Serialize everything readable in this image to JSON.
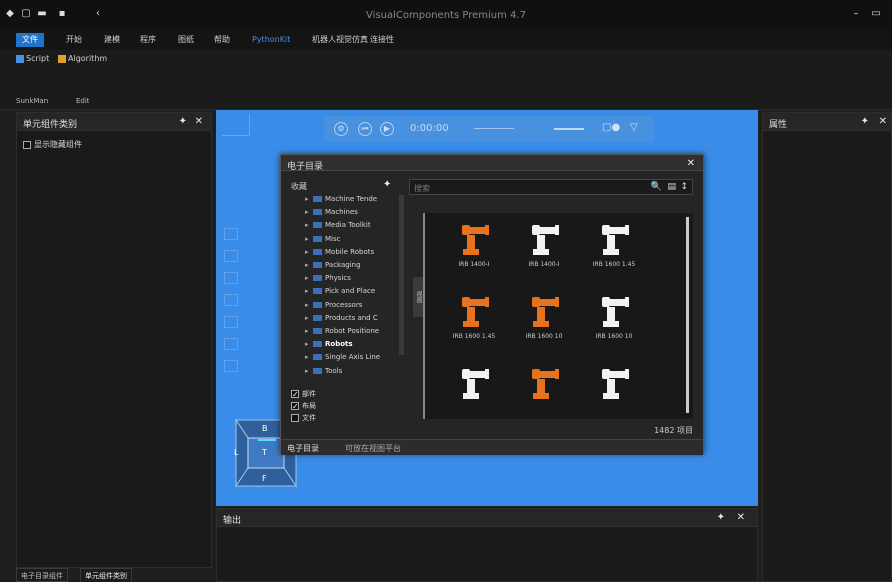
{
  "window": {
    "title": "VisualComponents Premium 4.7"
  },
  "ribbon": {
    "tabs": [
      {
        "label": "文件",
        "active": true
      },
      {
        "label": "开始"
      },
      {
        "label": "建模"
      },
      {
        "label": "程序"
      },
      {
        "label": "图纸"
      },
      {
        "label": "帮助"
      },
      {
        "label": "PythonKit",
        "highlight": true
      },
      {
        "label": "机器人视觉仿真"
      },
      {
        "label": "连接性"
      }
    ],
    "items": [
      {
        "label": "Script",
        "icon": "script-icon"
      },
      {
        "label": "Algorithm",
        "icon": "algorithm-icon"
      }
    ],
    "groups": [
      "SunkMan",
      "Edit"
    ]
  },
  "left_panel": {
    "title": "单元组件类别",
    "checkbox_label": "显示隐藏组件"
  },
  "right_panel": {
    "title": "属性"
  },
  "bottom_tabs": [
    "电子目录组件",
    "单元组件类别"
  ],
  "viewport": {
    "time": "0:00:00"
  },
  "navcube": {
    "top": "B",
    "left": "L",
    "center": "T",
    "bottom": "F"
  },
  "output_panel": {
    "title": "输出"
  },
  "catalog": {
    "title": "电子目录",
    "tree_root": "收藏",
    "tree_items": [
      {
        "label": "Machine Tende"
      },
      {
        "label": "Machines"
      },
      {
        "label": "Media Toolkit"
      },
      {
        "label": "Misc"
      },
      {
        "label": "Mobile Robots"
      },
      {
        "label": "Packaging"
      },
      {
        "label": "Physics"
      },
      {
        "label": "Pick and Place"
      },
      {
        "label": "Processors"
      },
      {
        "label": "Products and C"
      },
      {
        "label": "Robot Positione"
      },
      {
        "label": "Robots",
        "bold": true
      },
      {
        "label": "Single Axis Line"
      },
      {
        "label": "Tools"
      }
    ],
    "filters": [
      {
        "label": "部件",
        "checked": true
      },
      {
        "label": "布局",
        "checked": true
      },
      {
        "label": "文件",
        "checked": false
      }
    ],
    "side_tab": "视图",
    "search_placeholder": "搜索",
    "tiles": [
      {
        "label": "IRB 1400-I",
        "color": "#e9731d"
      },
      {
        "label": "IRB 1400-I",
        "color": "#f2f2f2"
      },
      {
        "label": "IRB 1600 1.45",
        "color": "#f2f2f2"
      },
      {
        "label": "IRB 1600 1.45",
        "color": "#e9731d"
      },
      {
        "label": "IRB 1600 10",
        "color": "#e9731d"
      },
      {
        "label": "IRB 1600 10",
        "color": "#f2f2f2"
      },
      {
        "label": "",
        "color": "#f2f2f2"
      },
      {
        "label": "",
        "color": "#e9731d"
      },
      {
        "label": "",
        "color": "#f2f2f2"
      }
    ],
    "item_count": "1482 项目",
    "footer_tabs": [
      "电子目录",
      "可放在视图平台"
    ]
  }
}
